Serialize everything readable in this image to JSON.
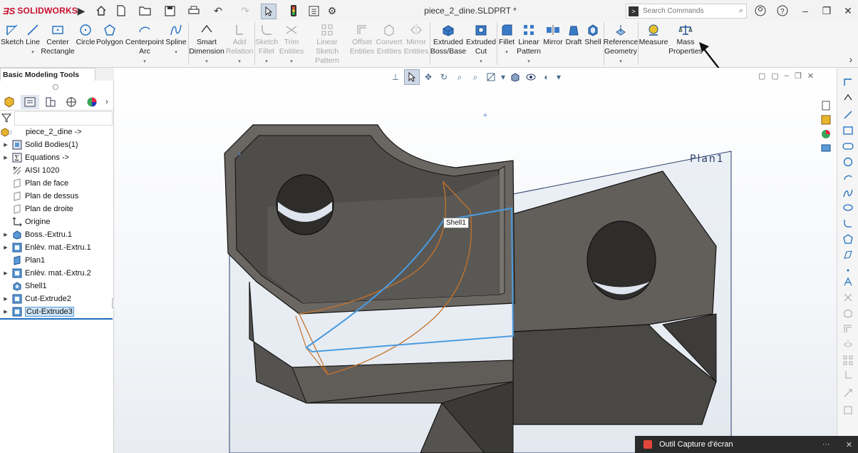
{
  "app": {
    "brand": "SOLIDWORKS",
    "document_title": "piece_2_dine.SLDPRT *"
  },
  "search": {
    "placeholder": "Search Commands"
  },
  "commands": [
    {
      "label": "Sketch",
      "icon": "sketch-icon",
      "enabled": true
    },
    {
      "label": "Line",
      "icon": "line-icon",
      "enabled": true
    },
    {
      "label": "Center Rectangle",
      "icon": "center-rectangle-icon",
      "enabled": true
    },
    {
      "label": "Circle",
      "icon": "circle-icon",
      "enabled": true
    },
    {
      "label": "Polygon",
      "icon": "polygon-icon",
      "enabled": true
    },
    {
      "label": "Centerpoint Arc",
      "icon": "arc-icon",
      "enabled": true
    },
    {
      "label": "Spline",
      "icon": "spline-icon",
      "enabled": true
    },
    {
      "label": "Smart Dimension",
      "icon": "smart-dimension-icon",
      "enabled": true
    },
    {
      "label": "Add Relation",
      "icon": "relation-icon",
      "enabled": false
    },
    {
      "label": "Sketch Fillet",
      "icon": "sketch-fillet-icon",
      "enabled": false
    },
    {
      "label": "Trim Entities",
      "icon": "trim-icon",
      "enabled": false
    },
    {
      "label": "Linear Sketch Pattern",
      "icon": "sketch-pattern-icon",
      "enabled": false
    },
    {
      "label": "Offset Entities",
      "icon": "offset-icon",
      "enabled": false
    },
    {
      "label": "Convert Entities",
      "icon": "convert-icon",
      "enabled": false
    },
    {
      "label": "Mirror Entities",
      "icon": "mirror-entities-icon",
      "enabled": false
    },
    {
      "label": "Extruded Boss/Base",
      "icon": "extruded-boss-icon",
      "enabled": true
    },
    {
      "label": "Extruded Cut",
      "icon": "extruded-cut-icon",
      "enabled": true
    },
    {
      "label": "Fillet",
      "icon": "fillet-icon",
      "enabled": true
    },
    {
      "label": "Linear Pattern",
      "icon": "linear-pattern-icon",
      "enabled": true
    },
    {
      "label": "Mirror",
      "icon": "mirror-icon",
      "enabled": true
    },
    {
      "label": "Draft",
      "icon": "draft-icon",
      "enabled": true
    },
    {
      "label": "Shell",
      "icon": "shell-icon",
      "enabled": true
    },
    {
      "label": "Reference Geometry",
      "icon": "reference-geometry-icon",
      "enabled": true
    },
    {
      "label": "Measure",
      "icon": "measure-icon",
      "enabled": true
    },
    {
      "label": "Mass Properties",
      "icon": "mass-properties-icon",
      "enabled": true
    }
  ],
  "toolbar_tab": {
    "label": "Basic Modeling Tools"
  },
  "tree": [
    {
      "label": "piece_2_dine ->",
      "icon": "part-icon",
      "expand": false
    },
    {
      "label": "Solid Bodies(1)",
      "icon": "solid-bodies-icon",
      "expand": true
    },
    {
      "label": "Equations ->",
      "icon": "equations-icon",
      "expand": true
    },
    {
      "label": "AISI 1020",
      "icon": "material-icon",
      "expand": false
    },
    {
      "label": "Plan de face",
      "icon": "plane-icon",
      "expand": false
    },
    {
      "label": "Plan de dessus",
      "icon": "plane-icon",
      "expand": false
    },
    {
      "label": "Plan de droite",
      "icon": "plane-icon",
      "expand": false
    },
    {
      "label": "Origine",
      "icon": "origin-icon",
      "expand": false
    },
    {
      "label": "Boss.-Extru.1",
      "icon": "extrude-feature-icon",
      "expand": true
    },
    {
      "label": "Enlèv. mat.-Extru.1",
      "icon": "cut-feature-icon",
      "expand": true
    },
    {
      "label": "Plan1",
      "icon": "plane-icon",
      "expand": false
    },
    {
      "label": "Enlèv. mat.-Extru.2",
      "icon": "cut-feature-icon",
      "expand": true
    },
    {
      "label": "Shell1",
      "icon": "shell-feature-icon",
      "expand": false
    },
    {
      "label": "Cut-Extrude2",
      "icon": "cut-feature-icon",
      "expand": true
    },
    {
      "label": "Cut-Extrude3",
      "icon": "cut-feature-icon",
      "expand": true,
      "selected": true
    }
  ],
  "viewport": {
    "plane_label": "Plan1",
    "tooltip": "Shell1"
  },
  "notification": {
    "text": "Outil Capture d'écran",
    "more": "···"
  },
  "colors": {
    "accent": "#1e6fbf",
    "brand": "#c8102e",
    "part": "#5c5a57",
    "selection": "#4a9be0",
    "preview": "#c7732a"
  }
}
